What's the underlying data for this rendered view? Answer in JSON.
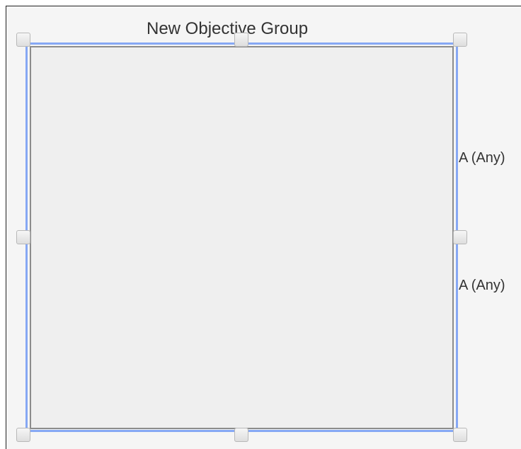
{
  "group": {
    "title": "New Objective Group"
  },
  "ports": {
    "port_1": "A (Any)",
    "port_2": "A (Any)"
  },
  "colors": {
    "selection_outline": "#86a8f4",
    "box_border": "#8c8c8c",
    "box_fill": "#efefef"
  }
}
